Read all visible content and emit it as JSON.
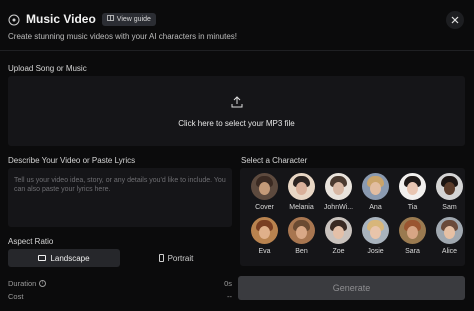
{
  "header": {
    "title": "Music Video",
    "guide_label": "View guide",
    "subtitle": "Create stunning music videos with your AI characters in minutes!"
  },
  "upload": {
    "label": "Upload Song or Music",
    "prompt": "Click here to select your MP3 file"
  },
  "description": {
    "label": "Describe Your Video or Paste Lyrics",
    "placeholder": "Tell us your video idea, story, or any details you'd like to include. You can also paste your lyrics here."
  },
  "characters": {
    "label": "Select a Character",
    "items": [
      {
        "name": "Cover",
        "skin": "#c49a78",
        "hair": "#3b2a22",
        "bg": "#5d4a3e"
      },
      {
        "name": "Melania",
        "skin": "#d9b09a",
        "hair": "#2b2320",
        "bg": "#e8d6c4"
      },
      {
        "name": "JohnWi...",
        "skin": "#d8b8a4",
        "hair": "#4a3a30",
        "bg": "#e9e3dc"
      },
      {
        "name": "Ana",
        "skin": "#e2bda1",
        "hair": "#caa46a",
        "bg": "#8a9ab0"
      },
      {
        "name": "Tia",
        "skin": "#e9c6b2",
        "hair": "#1f1a18",
        "bg": "#f2f0ee"
      },
      {
        "name": "Sam",
        "skin": "#5a3b2a",
        "hair": "#1b1412",
        "bg": "#d4d4d4"
      },
      {
        "name": "Eva",
        "skin": "#e0b08a",
        "hair": "#7a3f22",
        "bg": "#b9834f"
      },
      {
        "name": "Ben",
        "skin": "#d9a886",
        "hair": "#6a4a32",
        "bg": "#a87650"
      },
      {
        "name": "Zoe",
        "skin": "#e4c0a8",
        "hair": "#3a2a22",
        "bg": "#c9c2bd"
      },
      {
        "name": "Josie",
        "skin": "#e8c4aa",
        "hair": "#d8b67a",
        "bg": "#a9b3bd"
      },
      {
        "name": "Sara",
        "skin": "#d7a584",
        "hair": "#9a5530",
        "bg": "#9a7a50"
      },
      {
        "name": "Alice",
        "skin": "#e6c0a4",
        "hair": "#6a4a3a",
        "bg": "#a0a8b0"
      }
    ]
  },
  "aspect": {
    "label": "Aspect Ratio",
    "landscape_label": "Landscape",
    "portrait_label": "Portrait",
    "selected": "Landscape"
  },
  "stats": {
    "duration_label": "Duration",
    "duration_value": "0s",
    "cost_label": "Cost",
    "cost_value": "--"
  },
  "generate_label": "Generate",
  "colors": {
    "background": "#0b0b0c",
    "panel": "#151518",
    "button_disabled": "#3a3b3f"
  }
}
